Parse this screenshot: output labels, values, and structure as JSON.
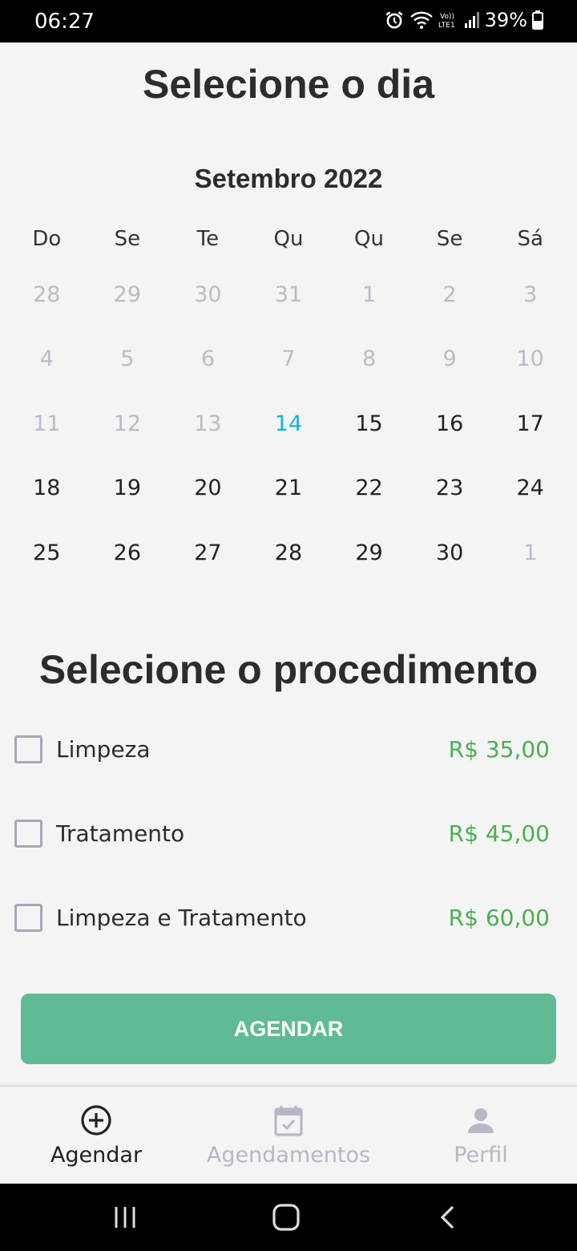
{
  "status_bar": {
    "time": "06:27",
    "battery": "39%"
  },
  "day_section": {
    "title": "Selecione o dia",
    "month": "Setembro 2022",
    "weekdays": [
      "Do",
      "Se",
      "Te",
      "Qu",
      "Qu",
      "Se",
      "Sá"
    ],
    "today": "14",
    "weeks": [
      [
        "28",
        "29",
        "30",
        "31",
        "1",
        "2",
        "3"
      ],
      [
        "4",
        "5",
        "6",
        "7",
        "8",
        "9",
        "10"
      ],
      [
        "11",
        "12",
        "13",
        "14",
        "15",
        "16",
        "17"
      ],
      [
        "18",
        "19",
        "20",
        "21",
        "22",
        "23",
        "24"
      ],
      [
        "25",
        "26",
        "27",
        "28",
        "29",
        "30",
        "1"
      ]
    ]
  },
  "procedure_section": {
    "title": "Selecione o procedimento",
    "items": [
      {
        "label": "Limpeza",
        "price": "R$ 35,00",
        "checked": false
      },
      {
        "label": "Tratamento",
        "price": "R$ 45,00",
        "checked": false
      },
      {
        "label": "Limpeza e Tratamento",
        "price": "R$ 60,00",
        "checked": false
      }
    ],
    "price_color": "#4caf50"
  },
  "cta": {
    "label": "AGENDAR",
    "color": "#5fbb95"
  },
  "tabbar": {
    "tabs": [
      {
        "label": "Agendar",
        "icon": "add-circle-icon",
        "active": true
      },
      {
        "label": "Agendamentos",
        "icon": "calendar-check-icon",
        "active": false
      },
      {
        "label": "Perfil",
        "icon": "person-icon",
        "active": false
      }
    ]
  },
  "accent_colors": {
    "today": "#19b3d4",
    "disabled_day": "#b9bcc4"
  }
}
